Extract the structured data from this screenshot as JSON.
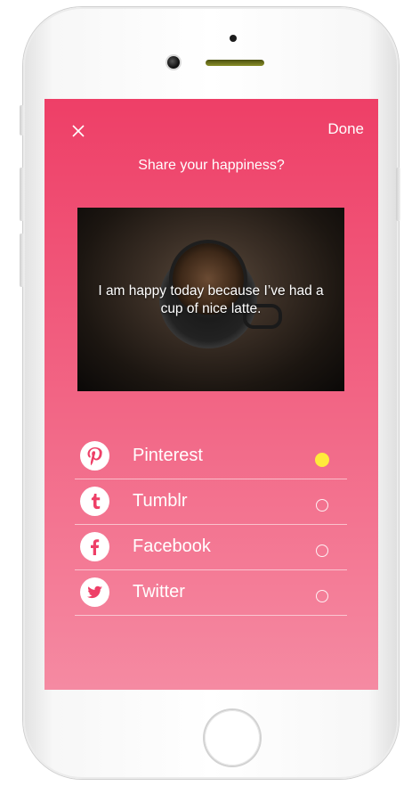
{
  "header": {
    "close_icon": "close-icon",
    "done_label": "Done",
    "title": "Share your happiness?"
  },
  "photo": {
    "caption": "I am happy today because I’ve had a cup of nice latte."
  },
  "share_options": [
    {
      "label": "Pinterest",
      "icon": "pinterest-icon",
      "selected": true
    },
    {
      "label": "Tumblr",
      "icon": "tumblr-icon",
      "selected": false
    },
    {
      "label": "Facebook",
      "icon": "facebook-icon",
      "selected": false
    },
    {
      "label": "Twitter",
      "icon": "twitter-icon",
      "selected": false
    }
  ],
  "colors": {
    "background_top": "#ee3f67",
    "background_bottom": "#f58aa2",
    "selected_radio": "#ffeb3b",
    "text": "#ffffff"
  }
}
